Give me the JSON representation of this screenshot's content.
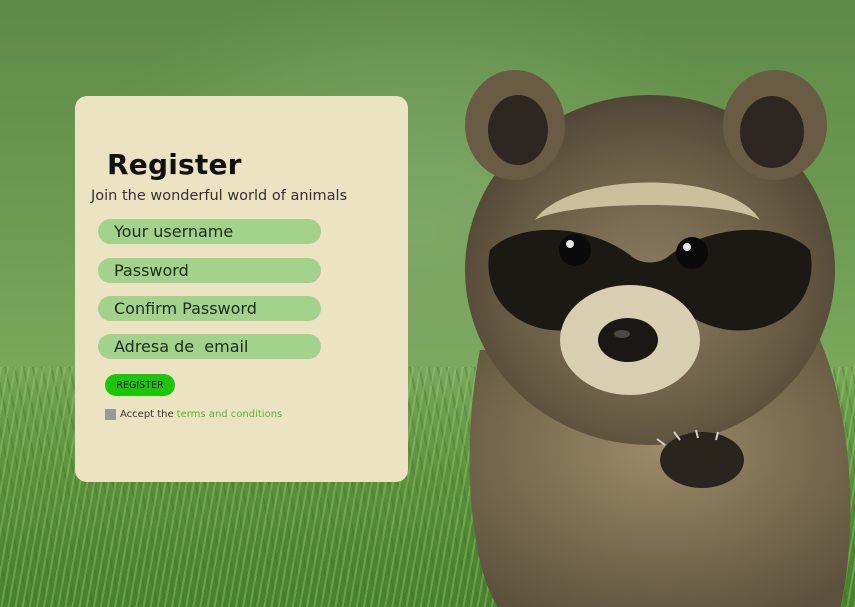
{
  "form": {
    "title": "Register",
    "subtitle": "Join the wonderful world of animals",
    "fields": {
      "username_placeholder": "Your username",
      "password_placeholder": "Password",
      "confirm_password_placeholder": "Confirm Password",
      "email_placeholder": "Adresa de  email"
    },
    "register_button": "REGISTER",
    "terms": {
      "prefix": "Accept the",
      "link": "terms and conditions"
    }
  },
  "background": {
    "subject": "raccoon-on-grass"
  },
  "colors": {
    "card": "#ebe3c2",
    "field": "#a3d28c",
    "button": "#1fc40f",
    "link": "#57b43a"
  }
}
